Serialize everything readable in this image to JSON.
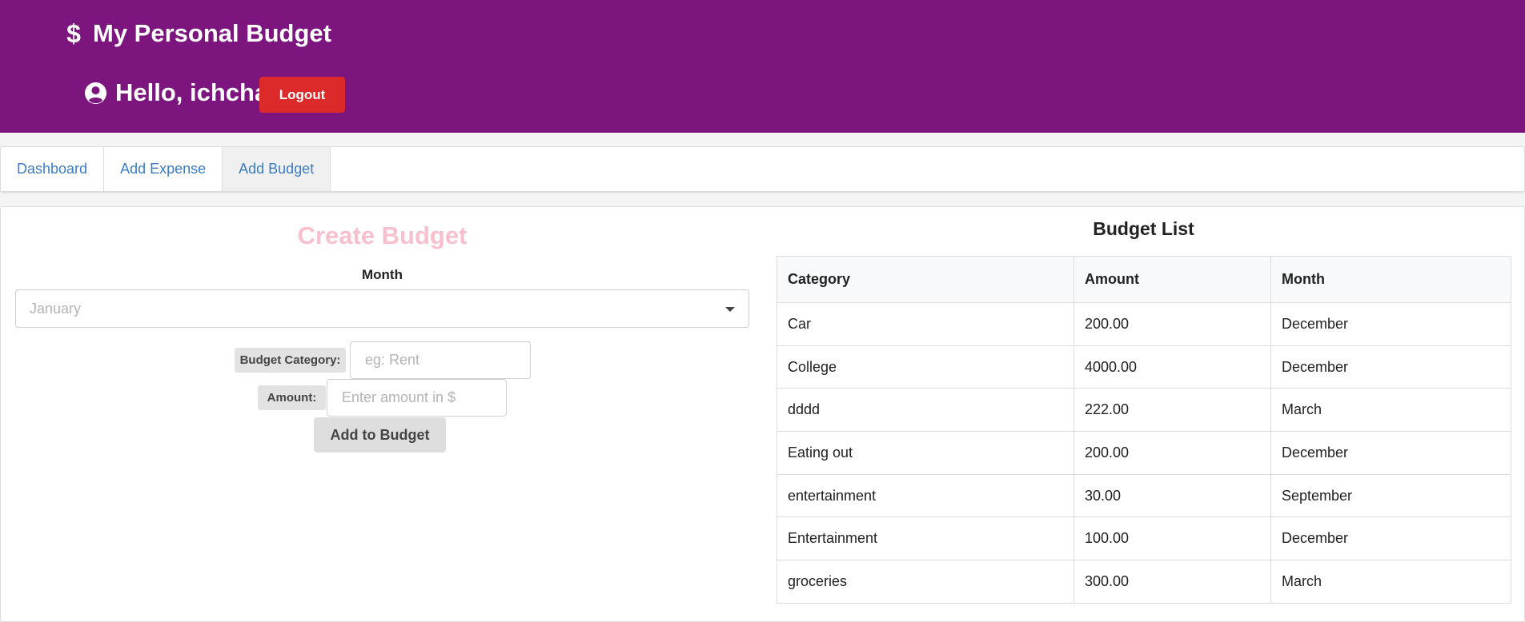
{
  "header": {
    "brand_icon": "dollar-icon",
    "title": "My Personal Budget",
    "user_icon": "user-circle-icon",
    "greeting": "Hello, ichcha!",
    "logout_label": "Logout",
    "background_color": "#7d157f",
    "logout_color": "#dc2a2a"
  },
  "nav": {
    "tabs": [
      {
        "label": "Dashboard",
        "active": false
      },
      {
        "label": "Add Expense",
        "active": false
      },
      {
        "label": "Add Budget",
        "active": true
      }
    ],
    "link_color": "#3b7dc4"
  },
  "create_budget": {
    "title": "Create Budget",
    "month_label": "Month",
    "month_value": "January",
    "category_label": "Budget Category:",
    "category_placeholder": "eg: Rent",
    "amount_label": "Amount:",
    "amount_placeholder": "Enter amount in $",
    "submit_label": "Add to Budget",
    "title_color": "#f8c0cc"
  },
  "budget_list": {
    "title": "Budget List",
    "columns": [
      "Category",
      "Amount",
      "Month"
    ],
    "rows": [
      [
        "Car",
        "200.00",
        "December"
      ],
      [
        "College",
        "4000.00",
        "December"
      ],
      [
        "dddd",
        "222.00",
        "March"
      ],
      [
        "Eating out",
        "200.00",
        "December"
      ],
      [
        "entertainment",
        "30.00",
        "September"
      ],
      [
        "Entertainment",
        "100.00",
        "December"
      ],
      [
        "groceries",
        "300.00",
        "March"
      ]
    ]
  }
}
